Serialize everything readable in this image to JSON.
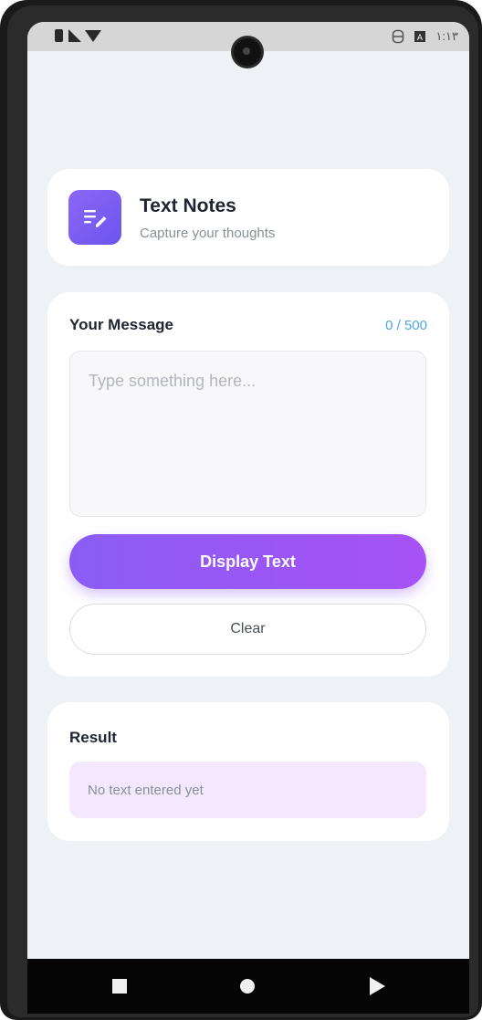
{
  "status_bar": {
    "time": "١:١٣"
  },
  "header": {
    "title": "Text Notes",
    "subtitle": "Capture your thoughts",
    "icon": "notes-edit-icon",
    "icon_gradient": [
      "#8c67f5",
      "#6b55ee"
    ]
  },
  "message": {
    "label": "Your Message",
    "char_count": "0 / 500",
    "input_value": "",
    "placeholder": "Type something here...",
    "display_button": "Display Text",
    "clear_button": "Clear"
  },
  "result": {
    "label": "Result",
    "text": "No text entered yet"
  },
  "nav": {
    "recents": "square-icon",
    "home": "circle-icon",
    "back": "triangle-icon"
  },
  "colors": {
    "accent": "#8a5cf6",
    "accent_end": "#a752f4",
    "counter": "#4fa3e6",
    "result_bg": "#f3e8fd",
    "screen_bg": "#eef1f6"
  }
}
